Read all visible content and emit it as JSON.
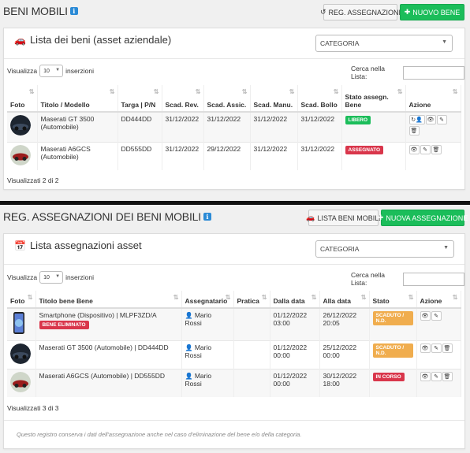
{
  "section1": {
    "title": "BENI MOBILI",
    "btn_reg": "REG. ASSEGNAZIONI",
    "btn_new": "NUOVO BENE",
    "panel_title": "Lista dei beni (asset aziendale)",
    "category_select": "CATEGORIA",
    "show_label": "Visualizza",
    "show_value": "10",
    "show_suffix": "inserzioni",
    "search_label": "Cerca nella Lista:",
    "columns": [
      "Foto",
      "Titolo / Modello",
      "Targa | P/N",
      "Scad. Rev.",
      "Scad. Assic.",
      "Scad. Manu.",
      "Scad. Bollo",
      "Stato assegn. Bene",
      "Azione"
    ],
    "rows": [
      {
        "title": "Maserati GT 3500 (Automobile)",
        "plate": "DD444DD",
        "rev": "31/12/2022",
        "assic": "31/12/2022",
        "manu": "31/12/2022",
        "bollo": "31/12/2022",
        "status": "LIBERO"
      },
      {
        "title": "Maserati A6GCS (Automobile)",
        "plate": "DD555DD",
        "rev": "31/12/2022",
        "assic": "29/12/2022",
        "manu": "31/12/2022",
        "bollo": "31/12/2022",
        "status": "ASSEGNATO"
      }
    ],
    "footer": "Visualizzati 2 di 2"
  },
  "section2": {
    "title": "REG. ASSEGNAZIONI DEI BENI MOBILI",
    "btn_list": "LISTA BENI MOBILI",
    "btn_new": "NUOVA ASSEGNAZIONE",
    "panel_title": "Lista assegnazioni asset",
    "category_select": "CATEGORIA",
    "show_label": "Visualizza",
    "show_value": "10",
    "show_suffix": "inserzioni",
    "search_label": "Cerca nella Lista:",
    "columns": [
      "Foto",
      "Titolo bene Bene",
      "Assegnatario",
      "Pratica",
      "Dalla data",
      "Alla data",
      "Stato",
      "Azione"
    ],
    "rows": [
      {
        "title": "Smartphone (Dispositivo) | MLPF3ZD/A",
        "sublabel": "BENE ELIMINATO",
        "user": "Mario Rossi",
        "from_date": "01/12/2022",
        "from_time": "03:00",
        "to_date": "26/12/2022",
        "to_time": "20:05",
        "status": "SCADUTO / N.D."
      },
      {
        "title": "Maserati GT 3500 (Automobile) | DD444DD",
        "sublabel": "",
        "user": "Mario Rossi",
        "from_date": "01/12/2022",
        "from_time": "00:00",
        "to_date": "25/12/2022",
        "to_time": "00:00",
        "status": "SCADUTO / N.D."
      },
      {
        "title": "Maserati A6GCS (Automobile) | DD555DD",
        "sublabel": "",
        "user": "Mario Rossi",
        "from_date": "01/12/2022",
        "from_time": "00:00",
        "to_date": "30/12/2022",
        "to_time": "18:00",
        "status": "IN CORSO"
      }
    ],
    "footer": "Visualizzati 3 di 3",
    "note": "Questo registro conserva i dati dell'assegnazione anche nel caso d'eliminazione del bene e/o della categoria."
  },
  "colors": {
    "success": "#1bbd5a",
    "danger": "#d9364b",
    "warning": "#f0ad4e",
    "info": "#2a8ad6"
  }
}
